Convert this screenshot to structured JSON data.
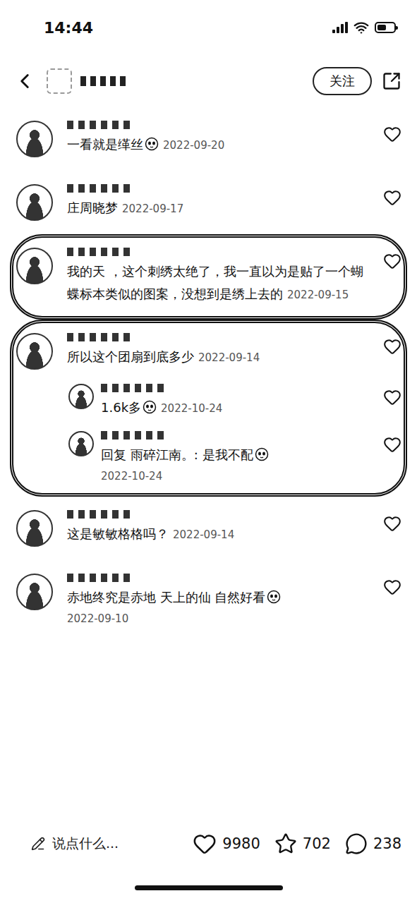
{
  "status_bar": {
    "time": "14:44"
  },
  "header": {
    "follow_button": "关注"
  },
  "comments": [
    {
      "text": "一看就是缂丝",
      "emoji": true,
      "date": "2022-09-20",
      "date_on_new_line": false,
      "liked": false,
      "circled": false,
      "replies": []
    },
    {
      "text": "庄周晓梦",
      "emoji": false,
      "date": "2022-09-17",
      "date_on_new_line": false,
      "liked": false,
      "circled": false,
      "replies": []
    },
    {
      "text": "我的天 ，这个刺绣太绝了，我一直以为是贴了一个蝴蝶标本类似的图案，没想到是绣上去的",
      "emoji": false,
      "date": "2022-09-15",
      "date_on_new_line": false,
      "liked": false,
      "circled": true,
      "replies": []
    },
    {
      "text": "所以这个团扇到底多少",
      "emoji": false,
      "date": "2022-09-14",
      "date_on_new_line": false,
      "liked": false,
      "circled": true,
      "replies": [
        {
          "text": "1.6k多",
          "emoji": true,
          "date": "2022-10-24",
          "date_on_new_line": false,
          "liked": false
        },
        {
          "text": "回复 雨碎江南。: 是我不配",
          "emoji": true,
          "date": "2022-10-24",
          "date_on_new_line": true,
          "liked": false
        }
      ]
    },
    {
      "text": "这是敏敏格格吗？",
      "emoji": false,
      "date": "2022-09-14",
      "date_on_new_line": false,
      "liked": false,
      "circled": false,
      "replies": []
    },
    {
      "text": "赤地终究是赤地 天上的仙 自然好看",
      "emoji": true,
      "date": "2022-09-10",
      "date_on_new_line": true,
      "liked": false,
      "circled": false,
      "replies": []
    }
  ],
  "footer": {
    "placeholder": "说点什么...",
    "likes": "9980",
    "favorites": "702",
    "comments": "238",
    "liked": false,
    "favorited": false
  }
}
